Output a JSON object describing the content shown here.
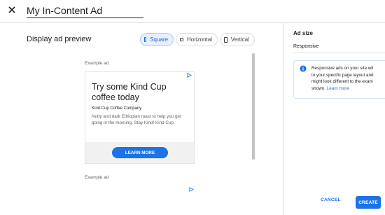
{
  "header": {
    "title": "My In-Content Ad"
  },
  "preview": {
    "title": "Display ad preview",
    "toggles": {
      "square": "Square",
      "horizontal": "Horizontal",
      "vertical": "Vertical"
    },
    "selected": "Square",
    "example_label": "Example ad",
    "ad": {
      "headline": "Try some Kind Cup coffee today",
      "company": "Kind Cup Coffee Company",
      "description": "Nutty and dark Ethiopian roast to help you get going in the morning. Stay Kind! Kind Cup.",
      "cta": "LEARN MORE"
    }
  },
  "sidebar": {
    "section_title": "Ad size",
    "size_value": "Responsive",
    "info": {
      "line1": "Responsive ads on your site wil",
      "line2": "to your specific page layout and",
      "line3": "might look different to the exam",
      "line4": "shown.",
      "link": "Learn more"
    }
  },
  "footer": {
    "cancel": "CANCEL",
    "create": "CREATE"
  },
  "colors": {
    "accent": "#1a73e8",
    "selected_toggle_bg": "#e8f0fe"
  }
}
